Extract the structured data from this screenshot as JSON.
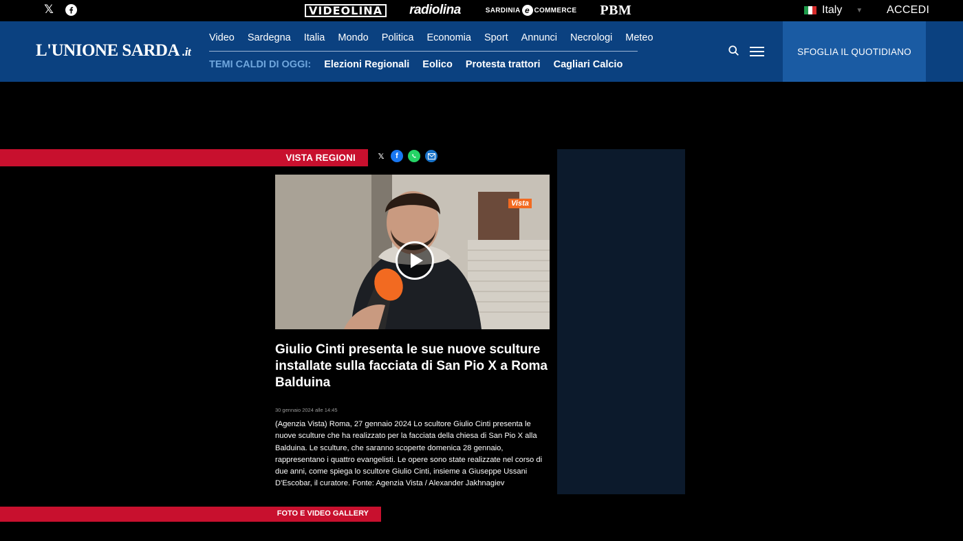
{
  "topbar": {
    "brands": {
      "videolina": "VIDEOLINA",
      "radiolina": "radiolina",
      "ecommerce_prefix": "SARDINIA",
      "ecommerce_e": "e",
      "ecommerce_suffix": "COMMERCE",
      "pbm": "PBM"
    },
    "language": "Italy",
    "login": "ACCEDI"
  },
  "header": {
    "logo": "L'UNIONE SARDA",
    "logo_suffix": ".it",
    "nav": [
      "Video",
      "Sardegna",
      "Italia",
      "Mondo",
      "Politica",
      "Economia",
      "Sport",
      "Annunci",
      "Necrologi",
      "Meteo"
    ],
    "hot_label": "TEMI CALDI DI OGGI:",
    "hot_topics": [
      "Elezioni Regionali",
      "Eolico",
      "Protesta trattori",
      "Cagliari Calcio"
    ],
    "sfoglia": "SFOGLIA IL QUOTIDIANO"
  },
  "article": {
    "section": "VISTA REGIONI",
    "video_badge": "Vista",
    "headline": "Giulio Cinti presenta le sue nuove sculture installate sulla facciata di San Pio X a Roma Balduina",
    "date": "30 gennaio 2024 alle 14:45",
    "body": "(Agenzia Vista) Roma, 27 gennaio 2024 Lo scultore Giulio Cinti presenta le nuove sculture che ha realizzato per la facciata della chiesa di San Pio X alla Balduina. Le sculture, che saranno scoperte domenica 28 gennaio, rappresentano i quattro evangelisti. Le opere sono state realizzate nel corso di due anni, come spiega lo scultore Giulio Cinti, insieme a Giuseppe Ussani D'Escobar, il curatore. Fonte: Agenzia Vista / Alexander Jakhnagiev"
  },
  "gallery": {
    "title": "FOTO E VIDEO GALLERY"
  },
  "colors": {
    "header_blue": "#0b4180",
    "sfoglia_blue": "#1a5ba3",
    "section_red": "#c8102e"
  }
}
